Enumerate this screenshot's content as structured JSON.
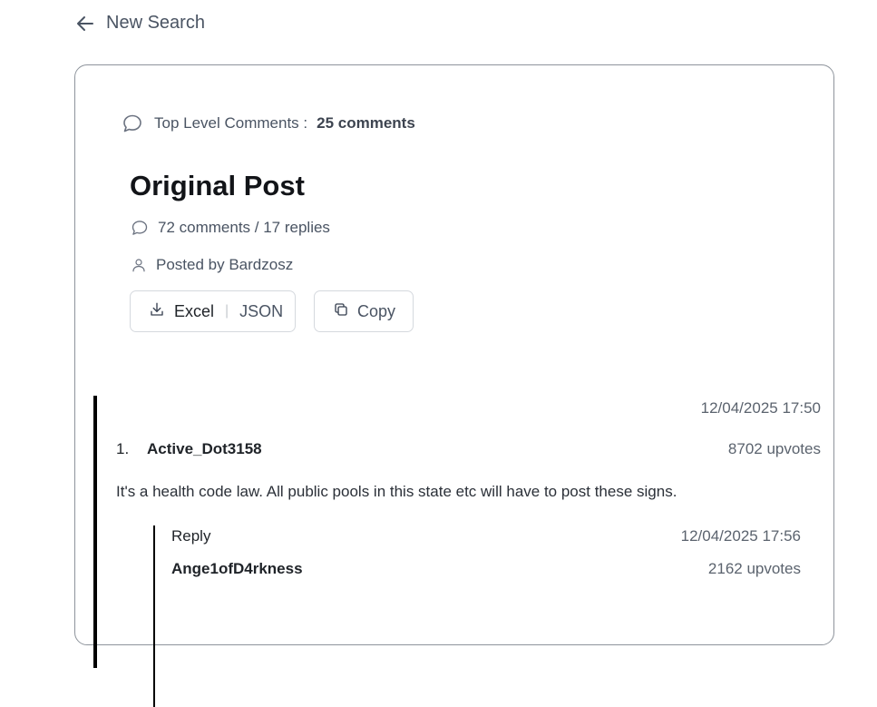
{
  "nav": {
    "back_label": "New Search",
    "back_icon": "arrow-left-icon"
  },
  "summary": {
    "top_level_label": "Top Level Comments :",
    "top_level_count": "25 comments",
    "icon": "chat-bubble-icon"
  },
  "post": {
    "title": "Original Post",
    "comments_replies": "72 comments / 17 replies",
    "author": "Posted by Bardzosz"
  },
  "actions": {
    "excel_label": "Excel",
    "separator": "|",
    "json_label": "JSON",
    "copy_label": "Copy"
  },
  "comments": [
    {
      "index": "1.",
      "author": "Active_Dot3158",
      "timestamp": "12/04/2025 17:50",
      "upvotes": "8702 upvotes",
      "body": "It's a health code law. All public pools in this state etc will have to post these signs.",
      "replies": [
        {
          "label": "Reply",
          "author": "Ange1ofD4rkness",
          "timestamp": "12/04/2025 17:56",
          "upvotes": "2162 upvotes",
          "body": ""
        }
      ]
    }
  ],
  "colors": {
    "border": "#8e949c",
    "thread_line": "#000000",
    "muted_text": "#4a5463"
  }
}
